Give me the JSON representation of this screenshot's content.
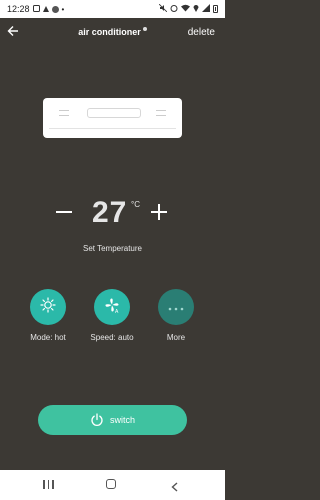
{
  "status_bar": {
    "time": "12:28"
  },
  "header": {
    "title": "air conditioner",
    "delete_label": "delete"
  },
  "temperature": {
    "value": "27",
    "unit": "°C",
    "label": "Set Temperature"
  },
  "controls": [
    {
      "label": "Mode: hot",
      "icon": "sun-icon"
    },
    {
      "label": "Speed: auto",
      "icon": "fan-icon"
    },
    {
      "label": "More",
      "icon": "more-icon"
    }
  ],
  "switch_button": {
    "label": "switch",
    "icon": "power-icon"
  },
  "colors": {
    "background": "#3c3934",
    "accent": "#2bb9a9",
    "switch": "#3fc2a0"
  }
}
